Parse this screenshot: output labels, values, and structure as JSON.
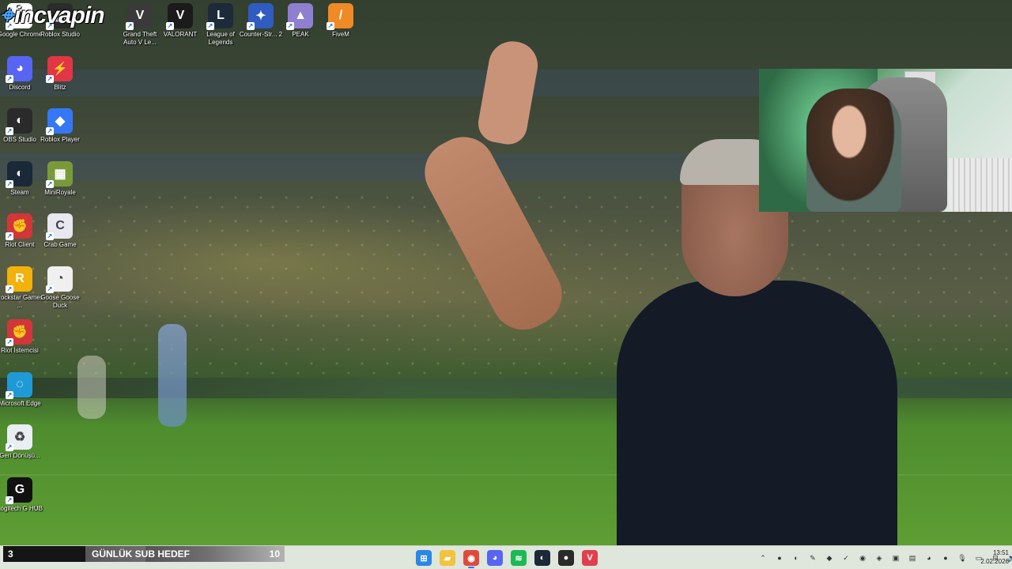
{
  "brand": {
    "text": "incvapin",
    "icon": "map-pin-icon"
  },
  "desktop_icons": [
    {
      "label": "Google Chrome",
      "icon": "chrome-icon",
      "color": "#ffffff"
    },
    {
      "label": "Roblox Studio",
      "icon": "roblox-studio-icon",
      "color": "#2b2b2b"
    },
    {
      "label": "Grand Theft Auto V Le...",
      "icon": "gta-v-icon",
      "color": "#3a3a3a"
    },
    {
      "label": "VALORANT",
      "icon": "valorant-icon",
      "color": "#1b1b1b"
    },
    {
      "label": "League of Legends",
      "icon": "league-of-legends-icon",
      "color": "#1d2a3a"
    },
    {
      "label": "Counter-Str... 2",
      "icon": "counter-strike-icon",
      "color": "#2f5cc0"
    },
    {
      "label": "PEAK",
      "icon": "peak-icon",
      "color": "#8f7fd0"
    },
    {
      "label": "FiveM",
      "icon": "fivem-icon",
      "color": "#f08a24"
    },
    {
      "label": "Discord",
      "icon": "discord-icon",
      "color": "#5865f2"
    },
    {
      "label": "Blitz",
      "icon": "blitz-icon",
      "color": "#e03646"
    },
    {
      "label": "OBS Studio",
      "icon": "obs-icon",
      "color": "#2a2a2a"
    },
    {
      "label": "Roblox Player",
      "icon": "roblox-player-icon",
      "color": "#3478f6"
    },
    {
      "label": "Steam",
      "icon": "steam-icon",
      "color": "#1b2838"
    },
    {
      "label": "MiniRoyale",
      "icon": "miniroyale-icon",
      "color": "#7a9a3a"
    },
    {
      "label": "Riot Client",
      "icon": "riot-client-icon",
      "color": "#d13639"
    },
    {
      "label": "Crab Game",
      "icon": "crab-game-icon",
      "color": "#e8e8f0"
    },
    {
      "label": "Rockstar Games ...",
      "icon": "rockstar-icon",
      "color": "#f2b20b"
    },
    {
      "label": "Goose Goose Duck",
      "icon": "goose-goose-duck-icon",
      "color": "#f0f0f0"
    },
    {
      "label": "Riot İstemcisi",
      "icon": "riot-istemcisi-icon",
      "color": "#d13639"
    },
    {
      "label": "Microsoft Edge",
      "icon": "edge-icon",
      "color": "#1f9ad7"
    },
    {
      "label": "Geri Dönüşü...",
      "icon": "recycle-bin-icon",
      "color": "#e9eef2"
    },
    {
      "label": "Logitech G HUB",
      "icon": "logitech-ghub-icon",
      "color": "#111111"
    }
  ],
  "sub_goal": {
    "current": "3",
    "title": "GÜNLÜK SUB HEDEF",
    "target": "10",
    "progress_fraction": 0.3
  },
  "taskbar": {
    "pinned": [
      {
        "name": "windows-start-icon",
        "glyph": "⊞",
        "color": "#2b86e6"
      },
      {
        "name": "file-explorer-icon",
        "glyph": "▰",
        "color": "#f2c33d"
      },
      {
        "name": "chrome-taskbar-icon",
        "glyph": "◉",
        "color": "#de4b3c"
      },
      {
        "name": "discord-taskbar-icon",
        "glyph": "◕",
        "color": "#5865f2"
      },
      {
        "name": "spotify-taskbar-icon",
        "glyph": "≋",
        "color": "#1db954"
      },
      {
        "name": "steam-taskbar-icon",
        "glyph": "◐",
        "color": "#1b2838"
      },
      {
        "name": "obs-taskbar-icon",
        "glyph": "●",
        "color": "#2a2a2a"
      },
      {
        "name": "valorant-taskbar-icon",
        "glyph": "V",
        "color": "#e0404e"
      }
    ],
    "tray": [
      {
        "name": "chevron-up-icon",
        "glyph": "⌃"
      },
      {
        "name": "spotify-tray-icon",
        "glyph": "●"
      },
      {
        "name": "steam-tray-icon",
        "glyph": "◐"
      },
      {
        "name": "pen-tray-icon",
        "glyph": "✎"
      },
      {
        "name": "nvidia-tray-icon",
        "glyph": "◆"
      },
      {
        "name": "riot-tray-icon",
        "glyph": "✓"
      },
      {
        "name": "obs-tray-icon",
        "glyph": "◉"
      },
      {
        "name": "network-tray-icon",
        "glyph": "◈"
      },
      {
        "name": "battery-tray-icon",
        "glyph": "▣"
      },
      {
        "name": "app-tray-icon",
        "glyph": "▤"
      },
      {
        "name": "discord-tray-icon",
        "glyph": "◕"
      },
      {
        "name": "record-tray-icon",
        "glyph": "●"
      },
      {
        "name": "mic-tray-icon",
        "glyph": "🎙"
      },
      {
        "name": "display-tray-icon",
        "glyph": "▭"
      },
      {
        "name": "ethernet-tray-icon",
        "glyph": "⊟"
      },
      {
        "name": "volume-tray-icon",
        "glyph": "🔊"
      }
    ],
    "clock": {
      "time": "13:51",
      "date": "2.02.2026"
    }
  }
}
